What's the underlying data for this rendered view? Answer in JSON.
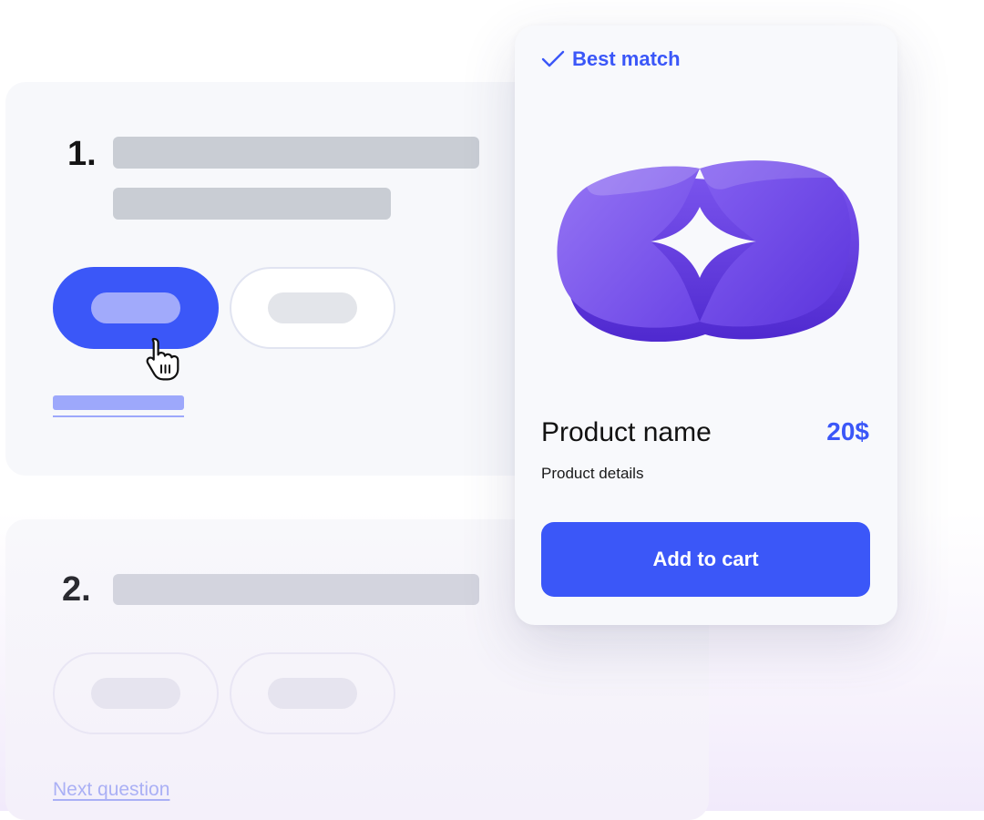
{
  "quiz": {
    "question_1": {
      "number": "1."
    },
    "question_2": {
      "number": "2."
    },
    "next_link": "Next question"
  },
  "product_card": {
    "badge_label": "Best match",
    "badge_icon": "check-icon",
    "name": "Product name",
    "price": "20$",
    "details": "Product details",
    "cta_label": "Add to cart"
  },
  "colors": {
    "accent": "#3b57f8",
    "accent_light": "#9da8fb",
    "placeholder": "#c9cdd4",
    "product_purple": "#8a63f0"
  }
}
